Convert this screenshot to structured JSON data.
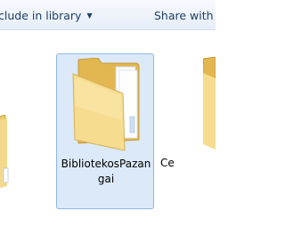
{
  "toolbar": {
    "include_label": "clude in library",
    "share_label": "Share with"
  },
  "items": [
    {
      "name": "",
      "icon": "folder-icon"
    },
    {
      "name": "BibliotekosPazangai",
      "icon": "folder-icon",
      "selected": true
    },
    {
      "name": "Ce",
      "icon": "folder-icon"
    }
  ]
}
